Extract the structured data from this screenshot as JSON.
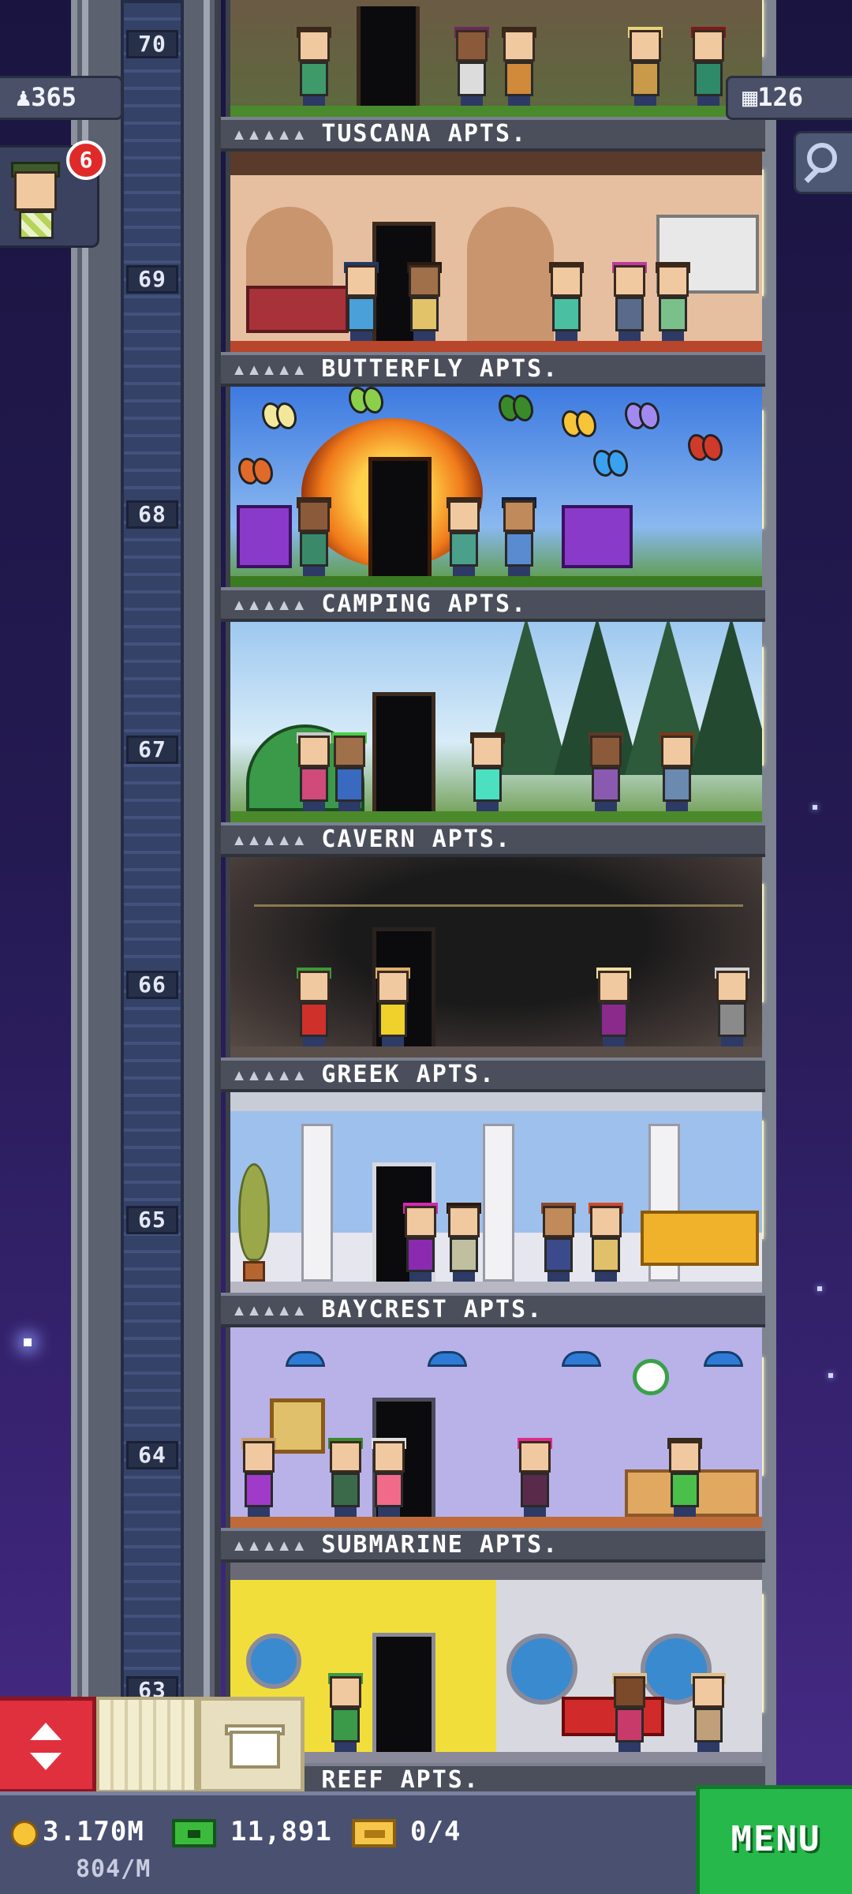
{
  "status": {
    "population": "365",
    "floors": "126",
    "notification_count": "6"
  },
  "floors": [
    {
      "number": "70",
      "name": "TUSCANA APTS."
    },
    {
      "number": "69",
      "name": "BUTTERFLY APTS."
    },
    {
      "number": "68",
      "name": "CAMPING APTS."
    },
    {
      "number": "67",
      "name": "CAVERN APTS."
    },
    {
      "number": "66",
      "name": "GREEK APTS."
    },
    {
      "number": "65",
      "name": "BAYCREST APTS."
    },
    {
      "number": "64",
      "name": "SUBMARINE APTS."
    },
    {
      "number": "63",
      "name": "REEF APTS."
    }
  ],
  "rating_dots": "▴▴▴▴▴",
  "hud": {
    "coins": "3.170M",
    "coins_rate": "804/M",
    "bux": "11,891",
    "tickets": "0/4",
    "menu_label": "MENU"
  },
  "icons": {
    "population": "person-icon",
    "floors": "building-icon",
    "search": "magnifier-icon",
    "elevator": "up-down-arrows-icon",
    "build": "box-icon",
    "coin": "coin-icon",
    "bux": "bux-icon",
    "ticket": "ticket-icon"
  },
  "colors": {
    "menu_green": "#26b84a",
    "elevator_red": "#e0303e",
    "notification_red": "#e02a2a"
  }
}
